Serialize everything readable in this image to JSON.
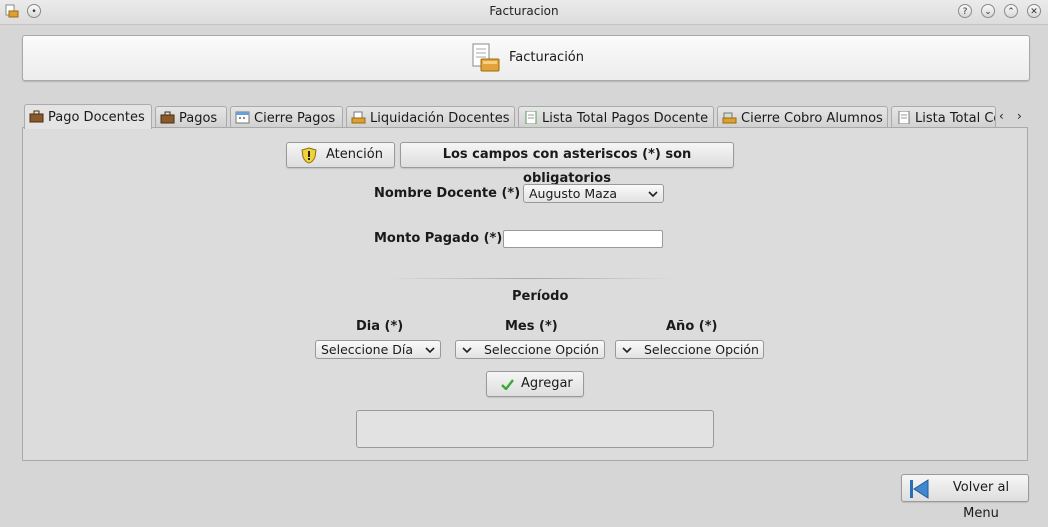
{
  "window": {
    "title": "Facturacion"
  },
  "banner": {
    "title": "Facturación"
  },
  "tabs": [
    {
      "label": "Pago Docentes",
      "icon": "briefcase-icon",
      "active": true
    },
    {
      "label": "Pagos",
      "icon": "briefcase-icon"
    },
    {
      "label": "Cierre Pagos",
      "icon": "calendar-icon"
    },
    {
      "label": "Liquidación Docentes",
      "icon": "printer-icon"
    },
    {
      "label": "Lista Total Pagos Docente",
      "icon": "document-icon"
    },
    {
      "label": "Cierre Cobro Alumnos",
      "icon": "cash-register-icon"
    },
    {
      "label": "Lista Total Cobro Alumnos",
      "icon": "document-icon"
    }
  ],
  "form": {
    "attention_label": "Atención",
    "notice": "Los campos con asteriscos (*) son obligatorios",
    "docente_label": "Nombre Docente (*)",
    "docente_value": "Augusto Maza",
    "monto_label": "Monto Pagado (*)",
    "monto_value": "",
    "periodo_label": "Período",
    "dia_label": "Dia (*)",
    "dia_value": "Seleccione Día",
    "mes_label": "Mes (*)",
    "mes_value": "Seleccione Opción",
    "anio_label": "Año (*)",
    "anio_value": "Seleccione Opción",
    "add_label": "Agregar"
  },
  "footer": {
    "back_label": "Volver al Menu"
  },
  "colors": {
    "background": "#d6d6d6",
    "panel": "#dcdcdc",
    "check": "#3aa83a",
    "back_icon": "#2a6fb5"
  }
}
